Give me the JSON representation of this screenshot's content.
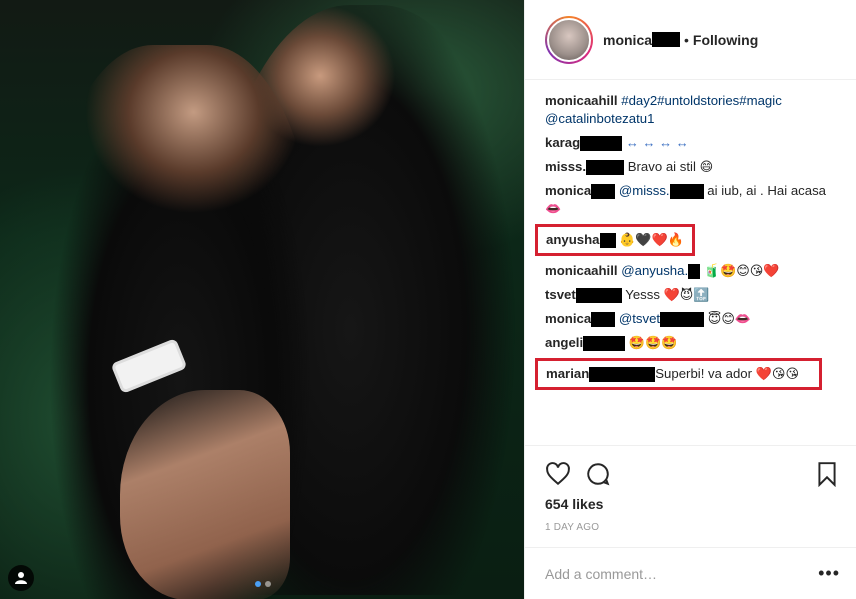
{
  "header": {
    "username": "monica",
    "separator": "•",
    "follow_status": "Following"
  },
  "comments": [
    {
      "user": "monicaahill",
      "hashtags": "#day2#untoldstories#magic",
      "mention": "@catalinbotezatu1"
    },
    {
      "user": "karag",
      "emoji": "↔ ↔ ↔ ↔"
    },
    {
      "user": "misss.",
      "text": "Bravo ai stil",
      "emoji": "😄"
    },
    {
      "user": "monica",
      "mention": "@misss.",
      "text": "ai iub, ai . Hai acasa",
      "emoji_after": "👄"
    },
    {
      "user": "anyusha",
      "emoji": "👶🖤❤️🔥"
    },
    {
      "user": "monicaahill",
      "mention": "@anyusha.",
      "emoji": "🧃🤩😊😘❤️"
    },
    {
      "user": "tsvet",
      "text": "Yesss",
      "emoji": "❤️😈🔝"
    },
    {
      "user": "monica",
      "mention": "@tsvet",
      "emoji": "😇😊👄"
    },
    {
      "user": "angeli",
      "emoji": "🤩🤩🤩"
    },
    {
      "user": "marian",
      "text": "Superbi! va ador",
      "emoji": "❤️😘😘"
    }
  ],
  "actions": {
    "likes": "654 likes",
    "time_ago": "1 DAY AGO"
  },
  "add_comment": {
    "placeholder": "Add a comment…",
    "more": "•••"
  },
  "colors": {
    "highlight": "#d52030",
    "link": "#003569",
    "accent_dot": "#4a9ff5"
  }
}
